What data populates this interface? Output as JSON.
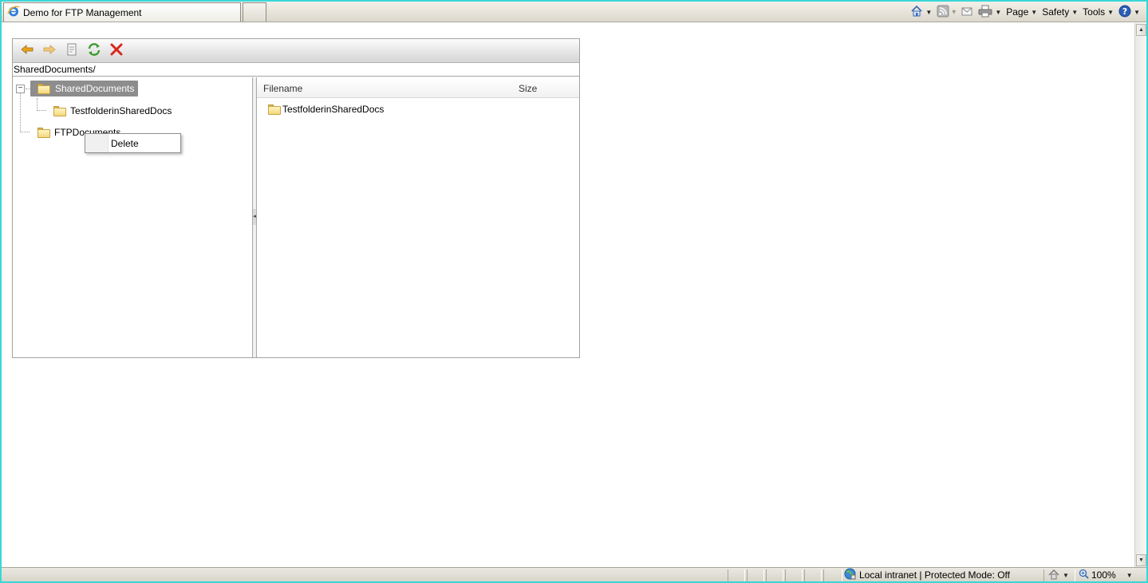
{
  "browser": {
    "tab_title": "Demo for FTP Management",
    "commands": {
      "page": "Page",
      "safety": "Safety",
      "tools": "Tools"
    },
    "icons": [
      "ie-logo-icon",
      "home-icon",
      "feeds-icon",
      "read-mail-icon",
      "print-icon",
      "help-icon"
    ]
  },
  "ftp": {
    "toolbar_icons": [
      "back-arrow-icon",
      "forward-arrow-icon",
      "properties-icon",
      "refresh-icon",
      "delete-icon"
    ],
    "current_path": "SharedDocuments/",
    "tree": {
      "root_selected": "SharedDocuments",
      "child": "TestfolderinSharedDocs",
      "second_root": "FTPDocuments"
    },
    "context_menu": {
      "items": [
        "Delete"
      ]
    },
    "files": {
      "columns": [
        "Filename",
        "Size"
      ],
      "rows": [
        {
          "name": "TestfolderinSharedDocs",
          "size": ""
        }
      ]
    }
  },
  "status": {
    "zone": "Local intranet | Protected Mode: Off",
    "zoom": "100%"
  },
  "colors": {
    "selection": "#8d8d8d",
    "delete_red": "#d9261c",
    "refresh_green": "#3b9a2c",
    "arrow_orange": "#e9a21d"
  }
}
